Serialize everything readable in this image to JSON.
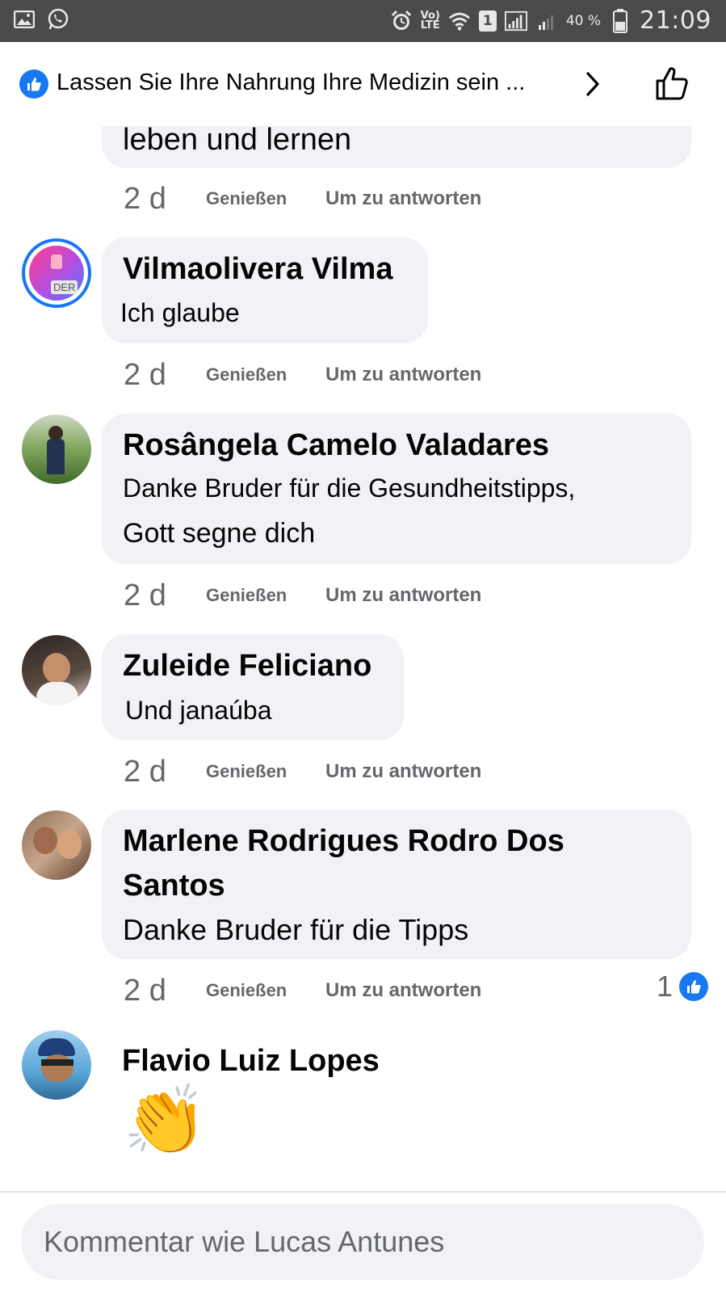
{
  "status_bar": {
    "left_icons": [
      "gallery-icon",
      "whatsapp-icon"
    ],
    "right_icons": [
      "alarm-icon",
      "volte-icon",
      "wifi-icon",
      "sim-icon",
      "signal-icon",
      "signal-weak-icon",
      "battery-icon"
    ],
    "volte_line1": "Vo)",
    "volte_line2": "LTE",
    "sim_number": "1",
    "battery_percent": "40 %",
    "time": "21:09"
  },
  "header": {
    "title": "Lassen Sie Ihre Nahrung Ihre Medizin sein ...",
    "badge_icon": "like-icon",
    "chevron_icon": "chevron-right-icon",
    "like_button_icon": "thumbs-up-icon"
  },
  "comments": [
    {
      "name": "",
      "lines": [
        "leben und lernen"
      ],
      "time": "2 d",
      "like_label": "Genießen",
      "reply_label": "Um zu antworten"
    },
    {
      "name": "Vilmaolivera Vilma",
      "lines": [
        "Ich glaube"
      ],
      "avatar_label": "DER",
      "time": "2 d",
      "like_label": "Genießen",
      "reply_label": "Um zu antworten"
    },
    {
      "name": "Rosângela Camelo Valadares",
      "lines": [
        "Danke Bruder für die Gesundheitstipps,",
        "Gott segne dich"
      ],
      "time": "2 d",
      "like_label": "Genießen",
      "reply_label": "Um zu antworten"
    },
    {
      "name": "Zuleide Feliciano",
      "lines": [
        "Und janaúba"
      ],
      "time": "2 d",
      "like_label": "Genießen",
      "reply_label": "Um zu antworten"
    },
    {
      "name_line1": "Marlene Rodrigues Rodro Dos",
      "name_line2": "Santos",
      "lines": [
        "Danke Bruder für die Tipps"
      ],
      "time": "2 d",
      "like_label": "Genießen",
      "reply_label": "Um zu antworten",
      "reaction_count": "1"
    },
    {
      "name": "Flavio Luiz Lopes",
      "emoji": "👏"
    }
  ],
  "composer": {
    "placeholder": "Kommentar wie Lucas Antunes"
  },
  "colors": {
    "brand_blue": "#1877f2",
    "bubble_bg": "#f0f2f5",
    "meta_gray": "#65676b",
    "status_bar": "#4a4a4a"
  }
}
